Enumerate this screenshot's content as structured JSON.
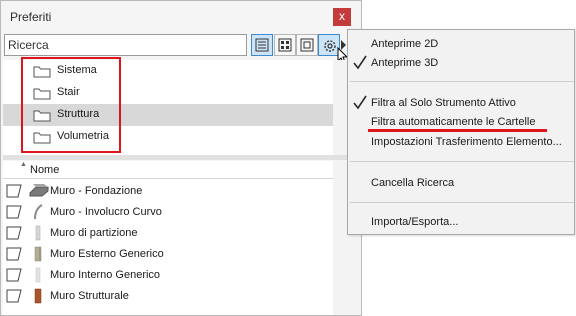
{
  "palette": {
    "title": "Preferiti",
    "close_glyph": "x",
    "search_value": "Ricerca",
    "folders": [
      {
        "label": "Sistema",
        "selected": false
      },
      {
        "label": "Stair",
        "selected": false
      },
      {
        "label": "Struttura",
        "selected": true
      },
      {
        "label": "Volumetria",
        "selected": false
      }
    ],
    "list_header": "Nome",
    "items": [
      {
        "label": "Muro - Fondazione",
        "icon": "wall-foundation-icon"
      },
      {
        "label": "Muro - Involucro Curvo",
        "icon": "curved-wall-icon"
      },
      {
        "label": "Muro di partizione",
        "icon": "partition-wall-icon"
      },
      {
        "label": "Muro Esterno Generico",
        "icon": "exterior-wall-icon"
      },
      {
        "label": "Muro Interno Generico",
        "icon": "interior-wall-icon"
      },
      {
        "label": "Muro Strutturale",
        "icon": "structural-wall-icon"
      }
    ]
  },
  "menu": {
    "items": [
      {
        "label": "Anteprime 2D",
        "checked": false
      },
      {
        "label": "Anteprime 3D",
        "checked": true
      },
      {
        "label": "Filtra al Solo Strumento Attivo",
        "checked": true
      },
      {
        "label": "Filtra automaticamente le Cartelle",
        "checked": false
      },
      {
        "label": "Impostazioni Trasferimento Elemento...",
        "checked": false
      },
      {
        "label": "Cancella Ricerca",
        "checked": false
      },
      {
        "label": "Importa/Esporta...",
        "checked": false
      }
    ]
  },
  "colors": {
    "highlight_red": "#e0141b",
    "close_red": "#c43b3b",
    "active_button": "#cce4f7",
    "selection_gray": "#d8d8d8"
  }
}
